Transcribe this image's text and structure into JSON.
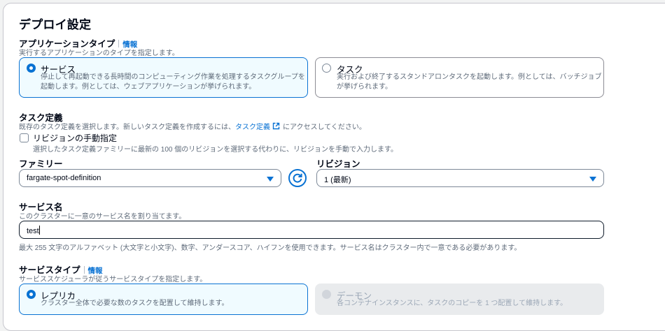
{
  "section_title": "デプロイ設定",
  "application_type": {
    "label": "アプリケーションタイプ",
    "info": "情報",
    "description": "実行するアプリケーションのタイプを指定します。",
    "options": [
      {
        "title": "サービス",
        "desc_line1": "停止して再起動できる長時間のコンピューティング作業を処理するタスクグループを",
        "desc_line2": "起動します。例としては、ウェブアプリケーションが挙げられます。",
        "selected": true
      },
      {
        "title": "タスク",
        "desc_line1": "実行および終了するスタンドアロンタスクを起動します。例としては、バッチジョブ",
        "desc_line2": "が挙げられます。",
        "selected": false
      }
    ]
  },
  "task_definition": {
    "label": "タスク定義",
    "description_prefix": "既存のタスク定義を選択します。新しいタスク定義を作成するには、",
    "link_text": "タスク定義",
    "description_suffix": "にアクセスしてください。",
    "manual_revision": {
      "label": "リビジョンの手動指定",
      "description": "選択したタスク定義ファミリーに最新の 100 個のリビジョンを選択する代わりに、リビジョンを手動で入力します。",
      "checked": false
    },
    "family": {
      "label": "ファミリー",
      "value": "fargate-spot-definition"
    },
    "revision": {
      "label": "リビジョン",
      "value": "1 (最新)"
    }
  },
  "service_name": {
    "label": "サービス名",
    "description": "このクラスターに一意のサービス名を割り当てます。",
    "value": "test",
    "constraint": "最大 255 文字のアルファベット (大文字と小文字)、数字、アンダースコア、ハイフンを使用できます。サービス名はクラスター内で一意である必要があります。"
  },
  "service_type": {
    "label": "サービスタイプ",
    "info": "情報",
    "description": "サービススケジューラが従うサービスタイプを指定します。",
    "options": [
      {
        "title": "レプリカ",
        "desc": "クラスター全体で必要な数のタスクを配置して維持します。",
        "selected": true,
        "disabled": false
      },
      {
        "title": "デーモン",
        "desc": "各コンテナインスタンスに、タスクのコピーを 1 つ配置して維持します。",
        "selected": false,
        "disabled": true
      }
    ]
  },
  "colors": {
    "accent": "#0972d3",
    "text": "#000716",
    "secondary_text": "#5f6b7a",
    "selected_tile_bg": "#f0fbff",
    "disabled_tile_bg": "#e9ebed"
  }
}
